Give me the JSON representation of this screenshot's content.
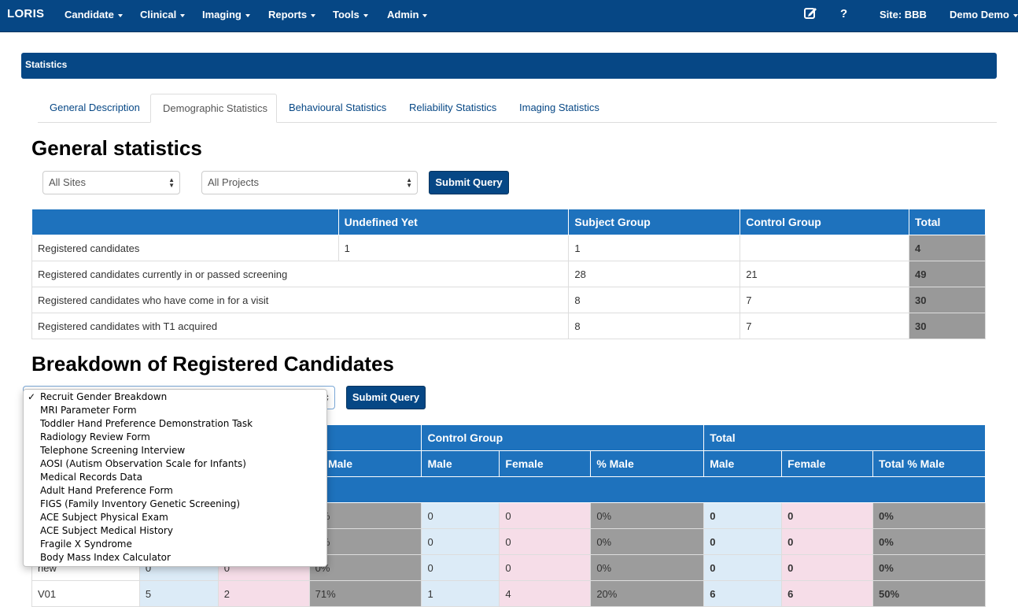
{
  "navbar": {
    "brand": "LORIS",
    "menus": [
      "Candidate",
      "Clinical",
      "Imaging",
      "Reports",
      "Tools",
      "Admin"
    ],
    "edit_icon": "edit-icon",
    "help_label": "?",
    "site": "Site: BBB",
    "user": "Demo Demo"
  },
  "panel": {
    "title": "Statistics"
  },
  "tabs": [
    "General Description",
    "Demographic Statistics",
    "Behavioural Statistics",
    "Reliability Statistics",
    "Imaging Statistics"
  ],
  "general": {
    "heading": "General statistics",
    "site_select": "All Sites",
    "project_select": "All Projects",
    "submit": "Submit Query",
    "headers": [
      "",
      "Undefined Yet",
      "Subject Group",
      "Control Group",
      "Total"
    ],
    "rows": [
      {
        "label": "Registered candidates",
        "undef": "1",
        "subject": "1",
        "control": "",
        "total": "4"
      },
      {
        "label": "Registered candidates currently in or passed screening",
        "undef": "",
        "subject": "28",
        "control": "21",
        "total": "49"
      },
      {
        "label": "Registered candidates who have come in for a visit",
        "undef": "",
        "subject": "8",
        "control": "7",
        "total": "30"
      },
      {
        "label": "Registered candidates with T1 acquired",
        "undef": "",
        "subject": "8",
        "control": "7",
        "total": "30"
      }
    ]
  },
  "breakdown": {
    "heading": "Breakdown of Registered Candidates",
    "submit": "Submit Query",
    "group_headers": [
      "Control Group",
      "Total"
    ],
    "sub_headers": [
      "% Male",
      "Male",
      "Female",
      "% Male",
      "Male",
      "Female",
      "Total % Male"
    ],
    "rows": [
      {
        "label": "",
        "sm": "",
        "sf": "",
        "sp": "0%",
        "cm": "0",
        "cf": "0",
        "cp": "0%",
        "tm": "0",
        "tf": "0",
        "tp": "0%"
      },
      {
        "label": "",
        "sm": "",
        "sf": "",
        "sp": "0%",
        "cm": "0",
        "cf": "0",
        "cp": "0%",
        "tm": "0",
        "tf": "0",
        "tp": "0%"
      },
      {
        "label": "new",
        "sm": "0",
        "sf": "0",
        "sp": "0%",
        "cm": "0",
        "cf": "0",
        "cp": "0%",
        "tm": "0",
        "tf": "0",
        "tp": "0%"
      },
      {
        "label": "V01",
        "sm": "5",
        "sf": "2",
        "sp": "71%",
        "cm": "1",
        "cf": "4",
        "cp": "20%",
        "tm": "6",
        "tf": "6",
        "tp": "50%"
      }
    ],
    "dropdown_options": [
      "Recruit Gender Breakdown",
      "MRI Parameter Form",
      "Toddler Hand Preference Demonstration Task",
      "Radiology Review Form",
      "Telephone Screening Interview",
      "AOSI (Autism Observation Scale for Infants)",
      "Medical Records Data",
      "Adult Hand Preference Form",
      "FIGS (Family Inventory Genetic Screening)",
      "ACE Subject Physical Exam",
      "ACE Subject Medical History",
      "Fragile X Syndrome",
      "Body Mass Index Calculator"
    ],
    "selected_check": "✓"
  }
}
